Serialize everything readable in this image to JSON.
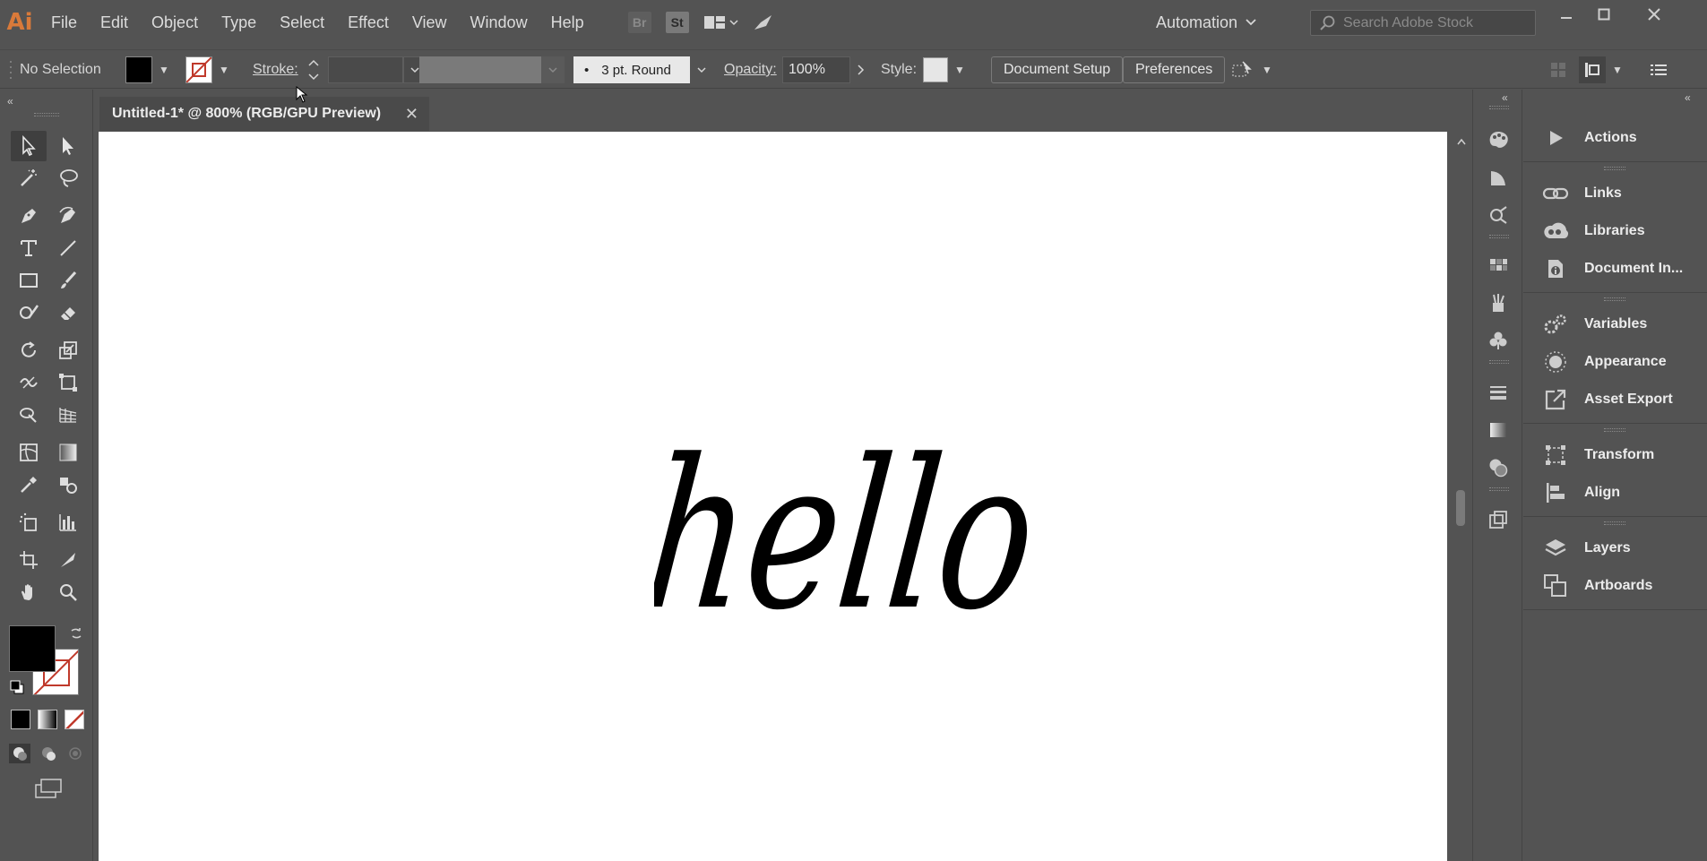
{
  "app": {
    "logo": "Ai"
  },
  "menu": [
    "File",
    "Edit",
    "Object",
    "Type",
    "Select",
    "Effect",
    "View",
    "Window",
    "Help"
  ],
  "menubar_icons": {
    "bridge": "Br",
    "stock": "St"
  },
  "workspace": {
    "label": "Automation"
  },
  "search": {
    "placeholder": "Search Adobe Stock"
  },
  "control": {
    "selection": "No Selection",
    "stroke_label": "Stroke:",
    "brush_label": "3 pt. Round",
    "opacity_label": "Opacity:",
    "opacity_value": "100%",
    "style_label": "Style:",
    "document_setup": "Document Setup",
    "preferences": "Preferences"
  },
  "document": {
    "tab_title": "Untitled-1* @ 800% (RGB/GPU Preview)",
    "artwork_text": "hello"
  },
  "panels": [
    {
      "label": "Actions",
      "icon": "play-icon"
    },
    {
      "label": "Links",
      "icon": "link-icon"
    },
    {
      "label": "Libraries",
      "icon": "cc-libraries-icon"
    },
    {
      "label": "Document In...",
      "icon": "info-icon"
    },
    {
      "label": "Variables",
      "icon": "gears-icon"
    },
    {
      "label": "Appearance",
      "icon": "sun-icon"
    },
    {
      "label": "Asset Export",
      "icon": "export-icon"
    },
    {
      "label": "Transform",
      "icon": "transform-icon"
    },
    {
      "label": "Align",
      "icon": "align-icon"
    },
    {
      "label": "Layers",
      "icon": "layers-icon"
    },
    {
      "label": "Artboards",
      "icon": "artboards-icon"
    }
  ],
  "colors": {
    "fill": "#000000",
    "accent_logo": "#d97a3a",
    "ui_bg": "#535353"
  }
}
